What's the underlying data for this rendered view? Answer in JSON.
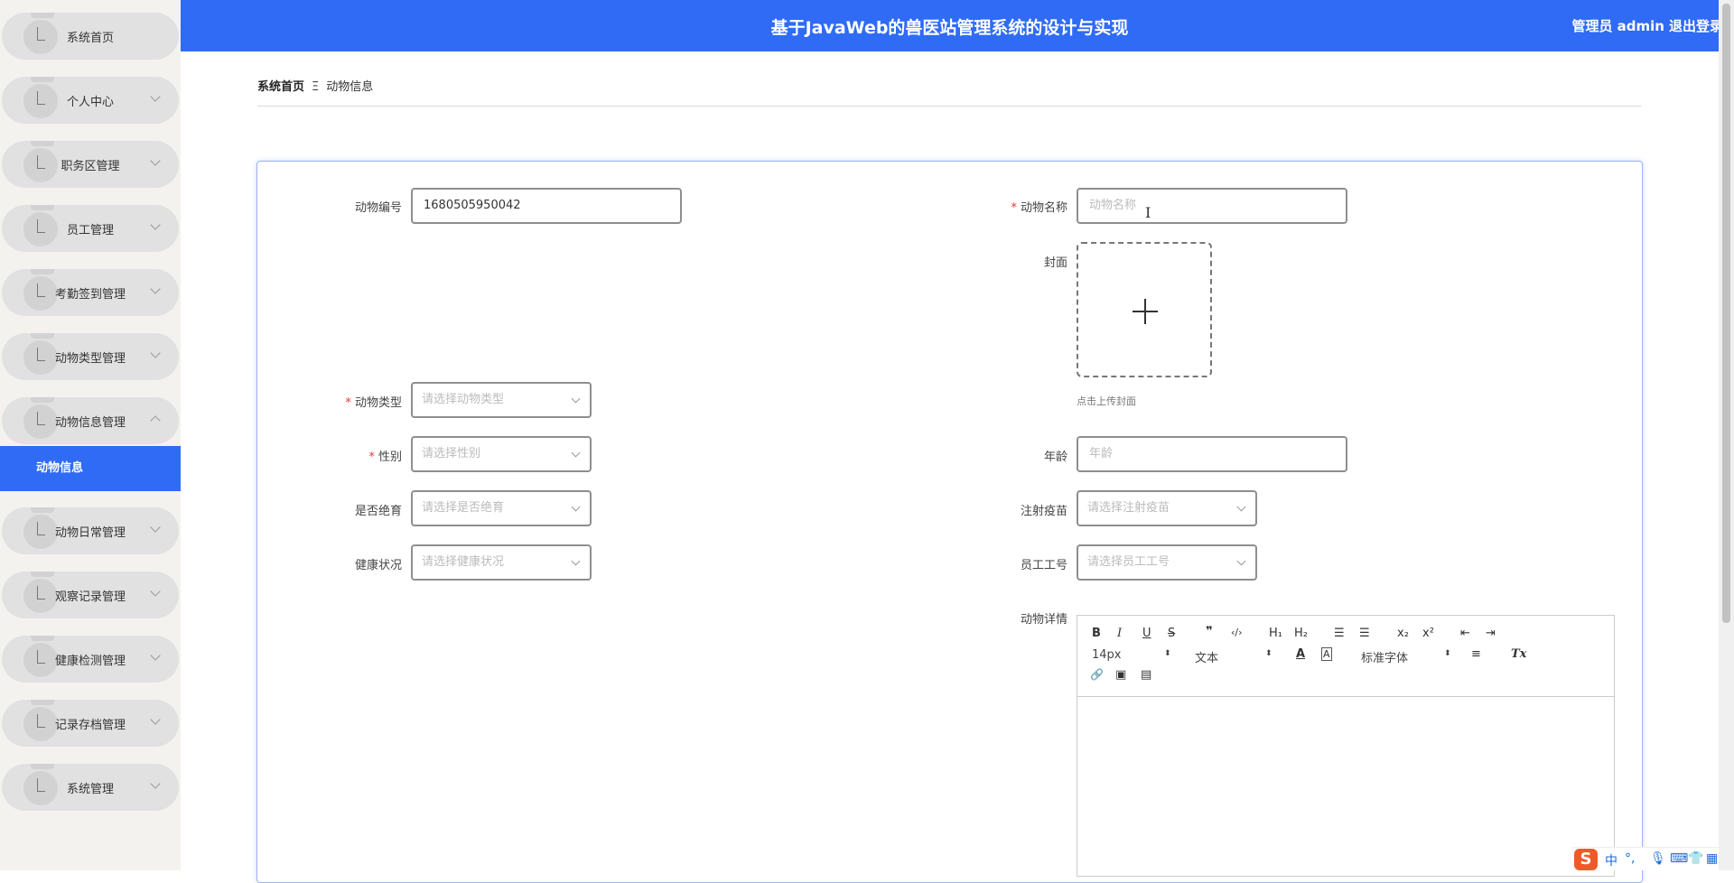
{
  "header": {
    "title": "基于JavaWeb的兽医站管理系统的设计与实现",
    "user": "管理员 admin",
    "logout": "退出登录"
  },
  "sidebar": {
    "items": [
      {
        "label": "系统首页"
      },
      {
        "label": "个人中心"
      },
      {
        "label": "职务区管理"
      },
      {
        "label": "员工管理"
      },
      {
        "label": "考勤签到管理"
      },
      {
        "label": "动物类型管理"
      },
      {
        "label": "动物信息管理"
      },
      {
        "label": "动物日常管理"
      },
      {
        "label": "观察记录管理"
      },
      {
        "label": "健康检测管理"
      },
      {
        "label": "记录存档管理"
      },
      {
        "label": "系统管理"
      }
    ],
    "active_sub": "动物信息"
  },
  "breadcrumb": {
    "home": "系统首页",
    "sep": "Ξ",
    "current": "动物信息"
  },
  "form": {
    "animal_no_label": "动物编号",
    "animal_no_value": "1680505950042",
    "animal_name_label": "动物名称",
    "animal_name_placeholder": "动物名称",
    "cover_label": "封面",
    "cover_tip": "点击上传封面",
    "type_label": "动物类型",
    "type_placeholder": "请选择动物类型",
    "gender_label": "性别",
    "gender_placeholder": "请选择性别",
    "age_label": "年龄",
    "age_placeholder": "年龄",
    "sterilized_label": "是否绝育",
    "sterilized_placeholder": "请选择是否绝育",
    "vaccine_label": "注射疫苗",
    "vaccine_placeholder": "请选择注射疫苗",
    "health_label": "健康状况",
    "health_placeholder": "请选择健康状况",
    "staff_label": "员工工号",
    "staff_placeholder": "请选择员工工号",
    "detail_label": "动物详情"
  },
  "editor": {
    "bold": "B",
    "italic": "I",
    "underline": "U",
    "strike": "S",
    "quote": "❞",
    "code": "‹/›",
    "h1": "H₁",
    "h2": "H₂",
    "ol": "☰",
    "ul": "☰",
    "sub": "x₂",
    "sup": "x²",
    "outdent": "⇤",
    "indent": "⇥",
    "size": "14px",
    "text": "文本",
    "font_color": "A",
    "bg_color": "A",
    "font": "标准字体",
    "align": "≡",
    "clean": "Tx",
    "link": "🔗",
    "image": "▣",
    "video": "▤"
  },
  "ime": {
    "logo": "S",
    "zh": "中",
    "punct": "°,"
  }
}
